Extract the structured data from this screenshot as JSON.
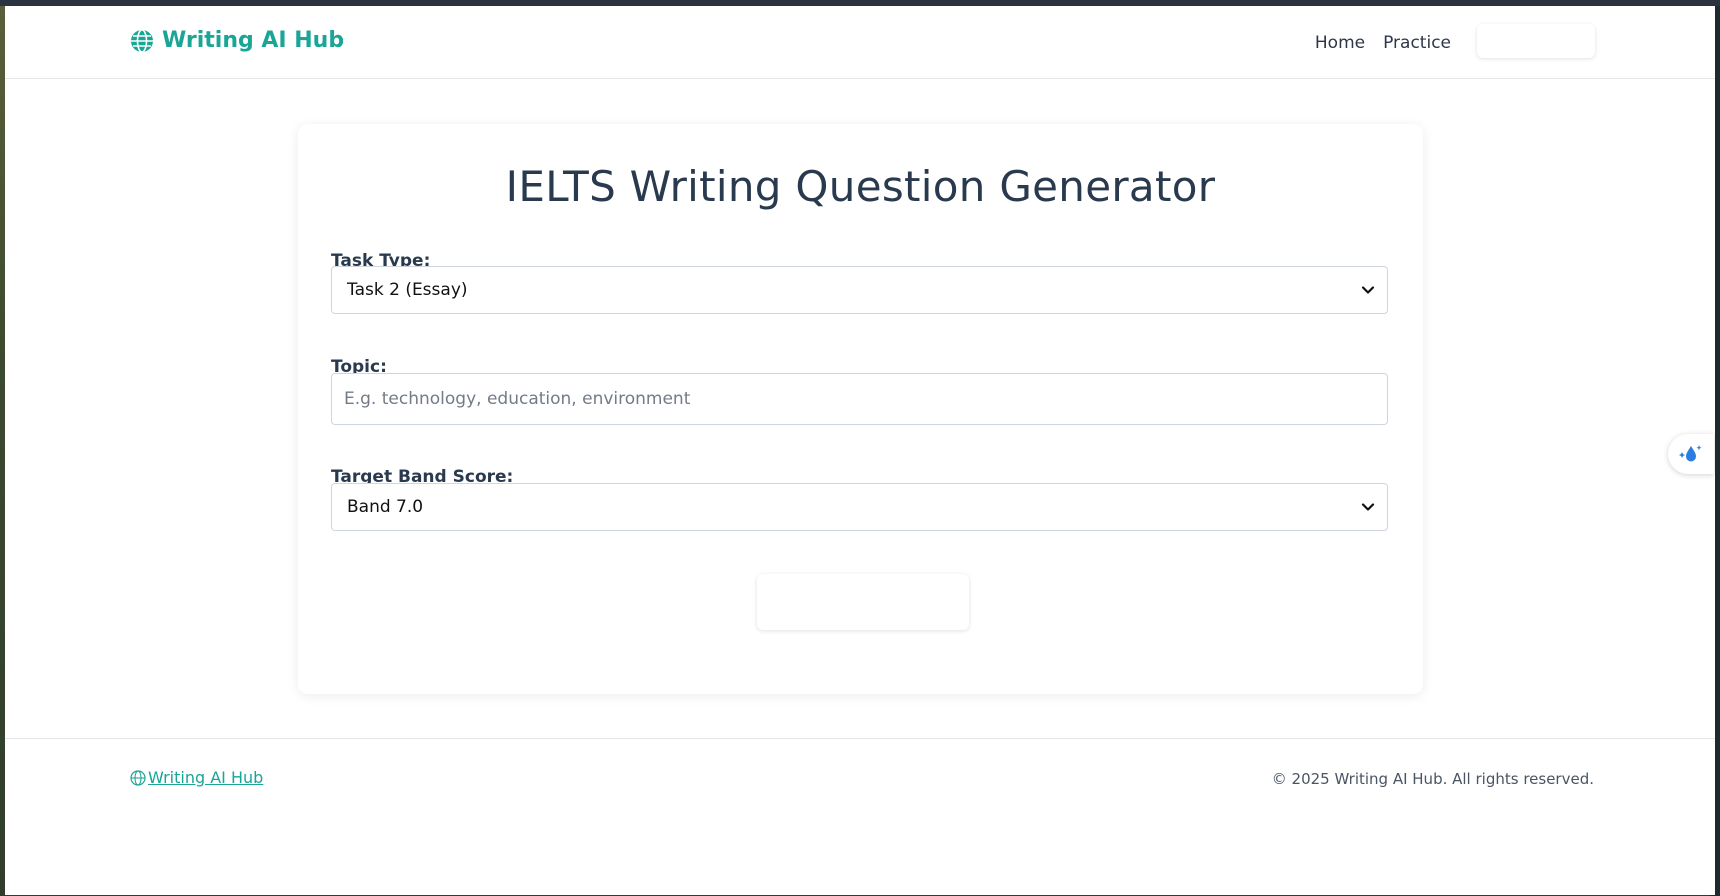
{
  "header": {
    "brand": "Writing AI Hub",
    "nav": {
      "home": "Home",
      "practice": "Practice",
      "action_label": ""
    }
  },
  "main": {
    "title": "IELTS Writing Question Generator",
    "task_type": {
      "label": "Task Type:",
      "selected": "Task 2 (Essay)"
    },
    "topic": {
      "label": "Topic:",
      "value": "",
      "placeholder": "E.g. technology, education, environment"
    },
    "band": {
      "label": "Target Band Score:",
      "selected": "Band 7.0"
    },
    "generate_label": ""
  },
  "footer": {
    "brand": "Writing AI Hub",
    "copyright": "© 2025 Writing AI Hub. All rights reserved."
  },
  "icons": {
    "brand": "globe-icon",
    "select_arrow": "chevron-down-icon",
    "widget": "droplet-sparkle-icon"
  },
  "colors": {
    "brand": "#1aa597",
    "heading": "#2a3a4e",
    "border": "#cfd6de"
  }
}
